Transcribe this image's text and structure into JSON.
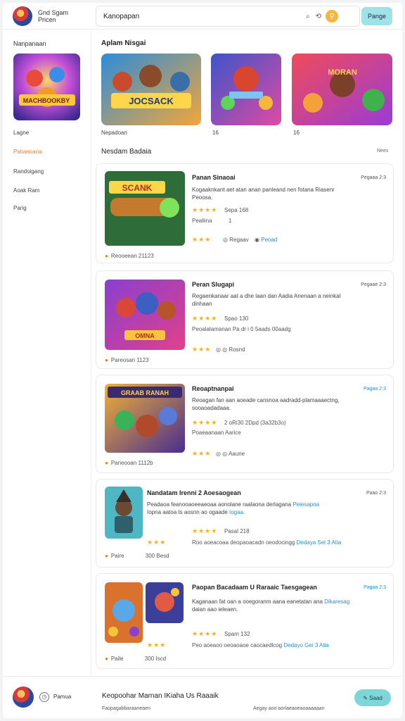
{
  "header": {
    "brand_line1": "Gnd Sgam",
    "brand_line2": "Pricen",
    "search_value": "Kanopapan",
    "action_label": "Pange",
    "icons": [
      "search-icon",
      "refresh-icon",
      "search-circle-icon"
    ]
  },
  "sidebar": {
    "title": "Nanpanaan",
    "items": [
      {
        "label": "Lagne",
        "active": false
      },
      {
        "label": "Patianoana",
        "active": true
      },
      {
        "label": "Randoigang",
        "active": false
      },
      {
        "label": "Aoak Ram",
        "active": false
      },
      {
        "label": "Parig",
        "active": false
      }
    ]
  },
  "featured": {
    "title": "Aplam Nisgai",
    "items": [
      {
        "caption": "Nepadoan",
        "art_text": "JOCSACK"
      },
      {
        "caption": "16",
        "art_text": ""
      },
      {
        "caption": "16",
        "art_text": "MORAN"
      }
    ],
    "side_art_text": "MACHBOOKBY"
  },
  "section": {
    "title": "Nesdam Badaia",
    "link": "Nees"
  },
  "cards": [
    {
      "title": "Panan Sinaoai",
      "date": "Pegaaa 2:3",
      "desc_line1": "Kogaaknkant aet atan anan panleand nen fotana Riasenr",
      "desc_line2": "Peoosa.",
      "stars_top": "★★★★",
      "meta_top": "Sepa 168",
      "meta_mid": "Pealiina",
      "meta_mid_extra": "1",
      "stars_bottom": "★★★",
      "meta_bottom_1": "Regaav",
      "meta_bottom_2": "Peoad",
      "footer": "Reooeean 21123",
      "art_text": "SCANK"
    },
    {
      "title": "Peran Slugapi",
      "date": "Pegaae 2:3",
      "desc_line1": "Regaenkanaar aat a dhe laan dan Aadia Anenaan a neinkal",
      "desc_line2": "dinhaan",
      "stars_top": "★★★★",
      "meta_top": "Spao 130",
      "meta_mid": "Peoalalamanan Pa dr i 0 5aads 00aadg",
      "meta_mid_extra": "",
      "stars_bottom": "★★★",
      "meta_bottom_1": "Rosnd",
      "meta_bottom_2": "",
      "footer": "Pareosan 1123",
      "art_text": "OMNA"
    },
    {
      "title": "Reoaptnanpai",
      "date": "Pagaa 2:3",
      "desc_line1": "Reoagan fan aan aoeade cansnoa aadradd-plamaaaectng,",
      "desc_line2": "sooaoadadaaa.",
      "stars_top": "★★★★",
      "meta_top": "2 oRi30 2Dpd (3a32b3o)",
      "meta_mid": "Poaeaanaan Aarice",
      "meta_mid_extra": "",
      "stars_bottom": "★★★",
      "meta_bottom_1": "Aaune",
      "meta_bottom_2": "",
      "footer": "Paneooan 1112b",
      "art_text": "GRAAB RANAH"
    },
    {
      "title": "Nandatam Irenni 2 Aoesaogean",
      "date": "Paao 2:3",
      "desc_line1": "Peadaoa feanooaoeeaeoaa aonolane raalaona derlagana",
      "desc_line1_link": "Peiesapoa",
      "desc_line2": "Iopna aatoa ts aosnn ao ogaade",
      "desc_line2_link": "Iogaa.",
      "stars_top": "★★★★",
      "meta_top": "Pasal 218",
      "stars_left": "★★★",
      "meta_bottom_text": "Roo aoeacoaa deopaoacadn oeodocingg",
      "meta_bottom_link": "Dedaya Sel 3 Atia",
      "footer_1": "Paire",
      "footer_2": "300 Besd",
      "art_text": ""
    },
    {
      "title": "Paopan Bacadaam U Raraaic Taesgagean",
      "date": "Pagaa 2:3",
      "desc_line1": "Kaganaan fat oan a ooegoranm aana eanetatan ana",
      "desc_line1_link": "Dikaresag",
      "desc_line2": "daian aao ieleaen.",
      "stars_top": "★★★★",
      "meta_top": "Spam 132",
      "stars_left": "★★★",
      "meta_bottom_text": "Peo aoeaoo oeoaoaoe caocaedlcog",
      "meta_bottom_link": "Dedayo Gei 3 Atia",
      "footer_1": "Paile",
      "footer_2": "300 Iscd",
      "art_text": ""
    }
  ],
  "bottom": {
    "label": "Pamua",
    "title": "Keopoohar Marnan IKiaha Us Raaaik",
    "sub_left": "Faopagabbaraaneaen",
    "sub_right": "Aegay aoo aorlaeaoeaoaaaaaan",
    "button": "Saad"
  },
  "colors": {
    "accent_orange": "#f07f1e",
    "star": "#f5b219",
    "link": "#2a8fd6",
    "teal_button": "#9fe3e6"
  }
}
